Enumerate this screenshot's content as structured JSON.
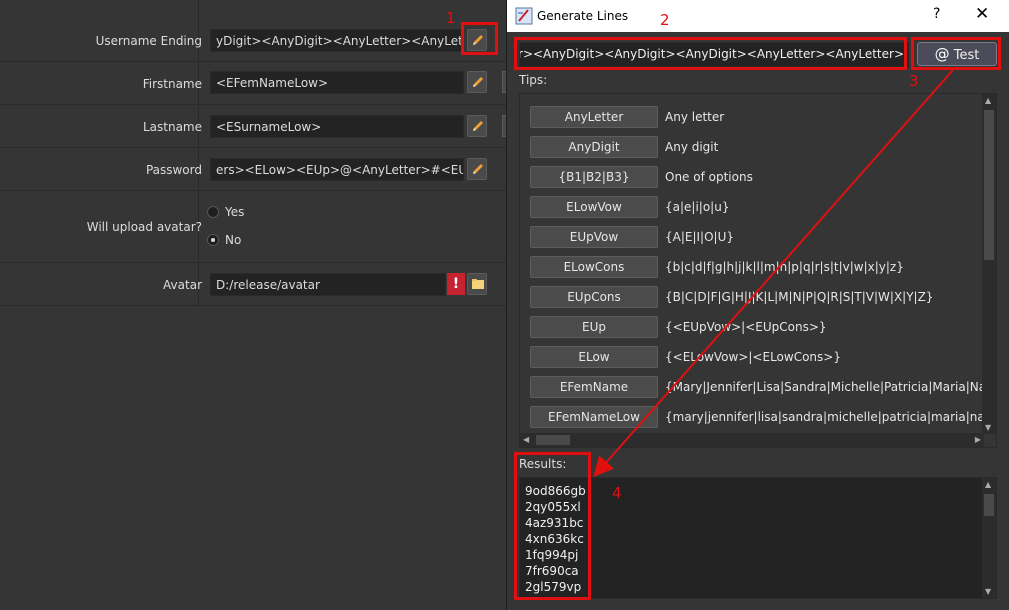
{
  "form": {
    "username_label": "Username Ending",
    "username_value": "yDigit><AnyDigit><AnyLetter><AnyLetter>",
    "firstname_label": "Firstname",
    "firstname_value": "<EFemNameLow>",
    "lastname_label": "Lastname",
    "lastname_value": "<ESurnameLow>",
    "password_label": "Password",
    "password_value": "ers><ELow><EUp>@<AnyLetter>#<EUp>",
    "avatar_q_label": "Will upload avatar?",
    "yes_label": "Yes",
    "no_label": "No",
    "no_selected": true,
    "avatar_label": "Avatar",
    "avatar_value": "D:/release/avatar",
    "warning_glyph": "!"
  },
  "dialog": {
    "title": "Generate Lines",
    "help_glyph": "?",
    "close_glyph": "✕",
    "expression": "yLetter><AnyDigit><AnyDigit><AnyDigit><AnyLetter><AnyLetter>",
    "test_at": "@",
    "test_label": "Test",
    "tips_label": "Tips:",
    "tips": [
      {
        "name": "AnyLetter",
        "desc": "Any letter"
      },
      {
        "name": "AnyDigit",
        "desc": "Any digit"
      },
      {
        "name": "{B1|B2|B3}",
        "desc": "One of options"
      },
      {
        "name": "ELowVow",
        "desc": "{a|e|i|o|u}"
      },
      {
        "name": "EUpVow",
        "desc": "{A|E|I|O|U}"
      },
      {
        "name": "ELowCons",
        "desc": "{b|c|d|f|g|h|j|k|l|m|n|p|q|r|s|t|v|w|x|y|z}"
      },
      {
        "name": "EUpCons",
        "desc": "{B|C|D|F|G|H|J|K|L|M|N|P|Q|R|S|T|V|W|X|Y|Z}"
      },
      {
        "name": "EUp",
        "desc": "{<EUpVow>|<EUpCons>}"
      },
      {
        "name": "ELow",
        "desc": "{<ELowVow>|<ELowCons>}"
      },
      {
        "name": "EFemName",
        "desc": "{Mary|Jennifer|Lisa|Sandra|Michelle|Patricia|Maria|Na"
      },
      {
        "name": "EFemNameLow",
        "desc": "{mary|jennifer|lisa|sandra|michelle|patricia|maria|na"
      }
    ],
    "results_label": "Results:",
    "results": [
      "9od866gb",
      "2qy055xl",
      "4az931bc",
      "4xn636kc",
      "1fq994pj",
      "7fr690ca",
      "2gl579vp"
    ]
  },
  "annotations": {
    "colors": {
      "highlight": "#e01010"
    },
    "labels": [
      "1",
      "2",
      "3",
      "4"
    ]
  }
}
